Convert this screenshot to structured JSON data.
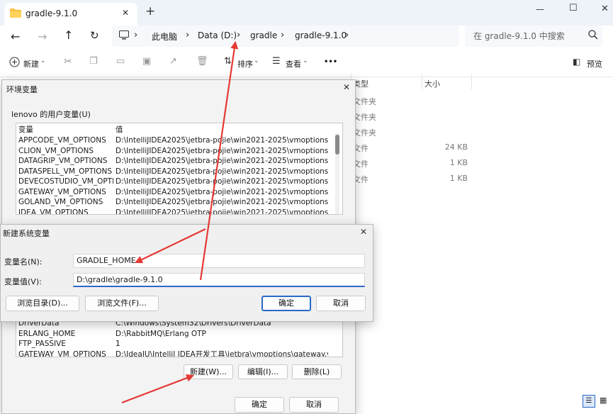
{
  "explorer": {
    "tab_title": "gradle-9.1.0",
    "new_tab": "+",
    "window_controls": {
      "minimize": "—",
      "maximize": "☐",
      "close": "✕"
    },
    "breadcrumb": [
      "此电脑",
      "Data (D:)",
      "gradle",
      "gradle-9.1.0"
    ],
    "search_placeholder": "在 gradle-9.1.0 中搜索",
    "toolbar": {
      "new_label": "新建",
      "sort_label": "排序",
      "view_label": "查看",
      "more": "•••",
      "preview_label": "预览"
    },
    "columns": {
      "type": "类型",
      "size": "大小"
    },
    "rows": [
      {
        "type": "文件夹",
        "size": ""
      },
      {
        "type": "文件夹",
        "size": ""
      },
      {
        "type": "文件夹",
        "size": ""
      },
      {
        "type": "文件",
        "size": "24 KB"
      },
      {
        "type": "文件",
        "size": "1 KB"
      },
      {
        "type": "文件",
        "size": "1 KB"
      }
    ]
  },
  "env_dialog": {
    "title": "环境变量",
    "close": "✕",
    "user_section_label": "lenovo 的用户变量(U)",
    "columns": {
      "var": "变量",
      "value": "值"
    },
    "user_vars": [
      {
        "name": "APPCODE_VM_OPTIONS",
        "value": "D:\\IntelliJIDEA2025\\jetbra-pojie\\win2021-2025\\vmoptions\\appco..."
      },
      {
        "name": "CLION_VM_OPTIONS",
        "value": "D:\\IntelliJIDEA2025\\jetbra-pojie\\win2021-2025\\vmoptions\\clion.v..."
      },
      {
        "name": "DATAGRIP_VM_OPTIONS",
        "value": "D:\\IntelliJIDEA2025\\jetbra-pojie\\win2021-2025\\vmoptions\\datagr..."
      },
      {
        "name": "DATASPELL_VM_OPTIONS",
        "value": "D:\\IntelliJIDEA2025\\jetbra-pojie\\win2021-2025\\vmoptions\\datas..."
      },
      {
        "name": "DEVECOSTUDIO_VM_OPTIO...",
        "value": "D:\\IntelliJIDEA2025\\jetbra-pojie\\win2021-2025\\vmoptions\\devec..."
      },
      {
        "name": "GATEWAY_VM_OPTIONS",
        "value": "D:\\IntelliJIDEA2025\\jetbra-pojie\\win2021-2025\\vmoptions\\gatew..."
      },
      {
        "name": "GOLAND_VM_OPTIONS",
        "value": "D:\\IntelliJIDEA2025\\jetbra-pojie\\win2021-2025\\vmoptions\\golan..."
      },
      {
        "name": "IDEA_VM_OPTIONS",
        "value": "D:\\IntelliJIDEA2025\\jetbra-pojie\\win2021-2025\\vmoptions\\idea.v..."
      }
    ],
    "system_vars": [
      {
        "name": "DriverData",
        "value": "C:\\Windows\\System32\\Drivers\\DriverData"
      },
      {
        "name": "ERLANG_HOME",
        "value": "D:\\RabbitMQ\\Erlang OTP"
      },
      {
        "name": "FTP_PASSIVE",
        "value": "1"
      },
      {
        "name": "GATEWAY_VM_OPTIONS",
        "value": "D:\\IdeaIU\\IntelliJ IDEA开发工具\\jetbra\\vmoptions\\gateway.vmopti"
      }
    ],
    "new_button": "新建(W)...",
    "edit_button": "编辑(I)...",
    "delete_button": "删除(L)",
    "ok_button": "确定",
    "cancel_button": "取消"
  },
  "new_var_dialog": {
    "title": "新建系统变量",
    "close": "✕",
    "name_label": "变量名(N):",
    "name_value": "GRADLE_HOME",
    "value_label": "变量值(V):",
    "value_value": "D:\\gradle\\gradle-9.1.0",
    "browse_dir_button": "浏览目录(D)...",
    "browse_file_button": "浏览文件(F)...",
    "ok_button": "确定",
    "cancel_button": "取消"
  },
  "colors": {
    "accent": "#2a68c6",
    "arrow": "#e53935"
  }
}
